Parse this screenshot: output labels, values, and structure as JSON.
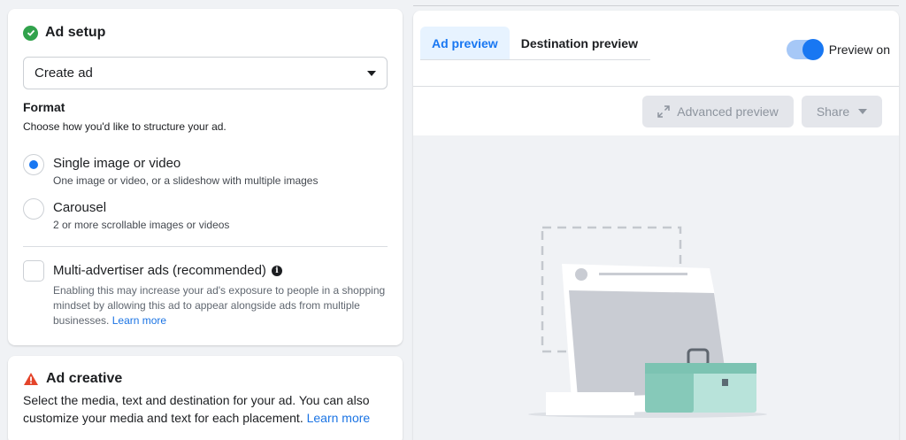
{
  "ad_setup": {
    "title": "Ad setup",
    "select_value": "Create ad",
    "format_label": "Format",
    "format_sub": "Choose how you'd like to structure your ad.",
    "options": [
      {
        "title": "Single image or video",
        "desc": "One image or video, or a slideshow with multiple images",
        "selected": true
      },
      {
        "title": "Carousel",
        "desc": "2 or more scrollable images or videos",
        "selected": false
      }
    ],
    "multi_advertiser": {
      "title": "Multi-advertiser ads (recommended)",
      "desc": "Enabling this may increase your ad's exposure to people in a shopping mindset by allowing this ad to appear alongside ads from multiple businesses.",
      "link": "Learn more"
    }
  },
  "ad_creative": {
    "title": "Ad creative",
    "desc": "Select the media, text and destination for your ad. You can also customize your media and text for each placement.",
    "link": "Learn more"
  },
  "preview": {
    "tabs": [
      "Ad preview",
      "Destination preview"
    ],
    "toggle_label": "Preview on",
    "advanced_label": "Advanced preview",
    "share_label": "Share"
  },
  "colors": {
    "accent": "#1877f2",
    "success": "#31a24c",
    "warning": "#e4442a"
  }
}
